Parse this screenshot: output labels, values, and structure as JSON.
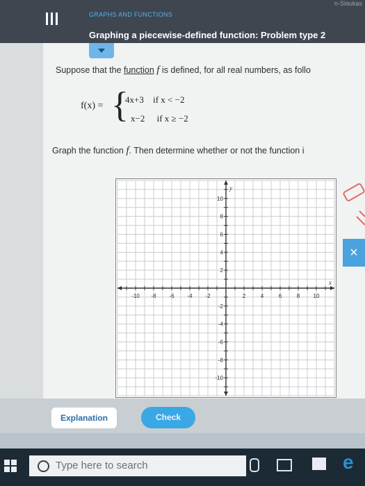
{
  "header": {
    "corner_text": "n-Sigukas",
    "category": "GRAPHS AND FUNCTIONS",
    "title": "Graphing a piecewise-defined function: Problem type 2"
  },
  "problem": {
    "intro_prefix": "Suppose that the ",
    "intro_link": "function",
    "intro_f": "f",
    "intro_suffix": " is defined, for all real numbers, as follo",
    "fx_label": "f(x) =",
    "cases": [
      {
        "expr": "4x+3",
        "condition": "if x < −2"
      },
      {
        "expr": "x−2",
        "condition": "if x ≥ −2"
      }
    ],
    "instruction_prefix": "Graph the function ",
    "instruction_f": "f",
    "instruction_suffix": ". Then determine whether or not the function i"
  },
  "graph": {
    "x_min": -12,
    "x_max": 12,
    "y_min": -12,
    "y_max": 12,
    "x_ticks": [
      "-10",
      "-8",
      "-6",
      "-4",
      "-2",
      "2",
      "4",
      "6",
      "8",
      "10"
    ],
    "y_ticks": [
      "10",
      "8",
      "6",
      "4",
      "2",
      "-2",
      "-4",
      "-6",
      "-8",
      "-10"
    ],
    "x_axis_label": "x",
    "y_axis_label": "y"
  },
  "buttons": {
    "explanation": "Explanation",
    "check": "Check",
    "close": "×"
  },
  "taskbar": {
    "search_placeholder": "Type here to search",
    "edge_glyph": "e"
  },
  "colors": {
    "header_bg": "#3f4650",
    "accent": "#3ba8e6",
    "taskbar": "#1c2a36"
  }
}
